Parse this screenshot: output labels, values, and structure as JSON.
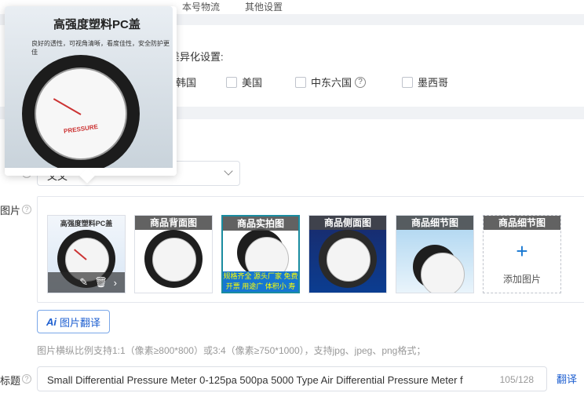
{
  "top_tabs": [
    "本号物流",
    "其他设置"
  ],
  "diff_settings": {
    "label": "差异化设置:",
    "countries": [
      {
        "name": "韩国",
        "checked": false
      },
      {
        "name": "美国",
        "checked": false
      },
      {
        "name": "中东六国",
        "checked": false,
        "help": true
      },
      {
        "name": "墨西哥",
        "checked": false
      }
    ],
    "help_icon": "?"
  },
  "select": {
    "value": "文文"
  },
  "images": {
    "label": "图片",
    "slots": [
      {
        "tag": "",
        "mini_title": "高强度塑料PC盖",
        "selected": false,
        "has_actions": true
      },
      {
        "tag": "商品背面图",
        "selected": false
      },
      {
        "tag": "商品实拍图",
        "selected": true,
        "strip_text": "规格齐全 源头厂家 免费开票 用途广 体积小 寿命长"
      },
      {
        "tag": "商品侧面图",
        "selected": false
      },
      {
        "tag": "商品细节图",
        "selected": false
      }
    ],
    "add_slot": {
      "tag": "商品细节图",
      "plus": "+",
      "label": "添加图片"
    },
    "actions": {
      "edit": "✎",
      "delete": "🗑",
      "more": "›"
    }
  },
  "ai_translate": {
    "badge": "Ai",
    "label": "图片翻译"
  },
  "hint": "图片横纵比例支持1:1（像素≥800*800）或3:4（像素≥750*1000），支持jpg、jpeg、png格式；",
  "title_field": {
    "label": "标题",
    "value": "Small Differential Pressure Meter 0-125pa 500pa 5000 Type Air Differential Pressure Meter f",
    "count": "105/128",
    "translate": "翻译"
  },
  "popover": {
    "title": "高强度塑料PC盖",
    "subtitle": "良好的透性，可视角清晰，看度佳性，安全防护更佳",
    "brand": "PRESSURE"
  }
}
